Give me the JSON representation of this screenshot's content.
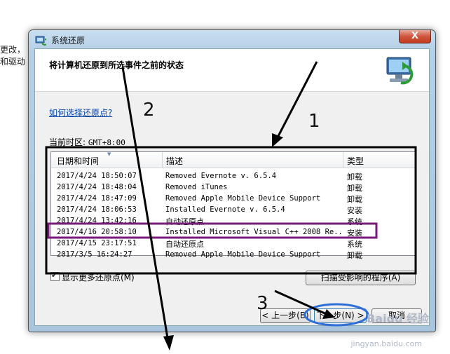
{
  "background": {
    "line1": "更改，",
    "line2": "和驱动"
  },
  "window": {
    "title": "系统还原",
    "close_label": "X",
    "heading": "将计算机还原到所选事件之前的状态",
    "help_link": "如何选择还原点?",
    "timezone_label": "当前时区:",
    "timezone_value": "GMT+8:00"
  },
  "table": {
    "columns": [
      "日期和时间",
      "描述",
      "类型"
    ],
    "rows": [
      {
        "date": "2017/4/24 18:50:07",
        "desc": "Removed Evernote v. 6.5.4",
        "type": "卸载"
      },
      {
        "date": "2017/4/24 18:48:04",
        "desc": "Removed iTunes",
        "type": "卸载"
      },
      {
        "date": "2017/4/24 18:47:09",
        "desc": "Removed Apple Mobile Device Support",
        "type": "卸载"
      },
      {
        "date": "2017/4/24 18:06:53",
        "desc": "Installed Evernote v. 6.5.4",
        "type": "安装"
      },
      {
        "date": "2017/4/24 13:42:16",
        "desc": "自动还原点",
        "type": "系统"
      },
      {
        "date": "2017/4/16 20:58:10",
        "desc": "Installed Microsoft Visual C++ 2008 Re...",
        "type": "安装"
      },
      {
        "date": "2017/4/15 23:17:51",
        "desc": "自动还原点",
        "type": "系统"
      },
      {
        "date": "2017/3/5 16:24:27",
        "desc": "Removed Apple Mobile Device Support",
        "type": "卸载"
      }
    ]
  },
  "more_restore_points": "显示更多还原点(M)",
  "buttons": {
    "scan": "扫描受影响的程序(A)",
    "back": "< 上一步(B)",
    "next": "下一步(N) >",
    "cancel": "取消"
  },
  "annotations": {
    "step1": "1",
    "step2": "2",
    "step3": "3",
    "color_box": "#000000",
    "color_highlight": "#7a1a7a",
    "color_ellipse": "#2f6fd6"
  },
  "watermark": {
    "logo": "Baidu 经验",
    "url": "jingyan.baidu.com"
  }
}
